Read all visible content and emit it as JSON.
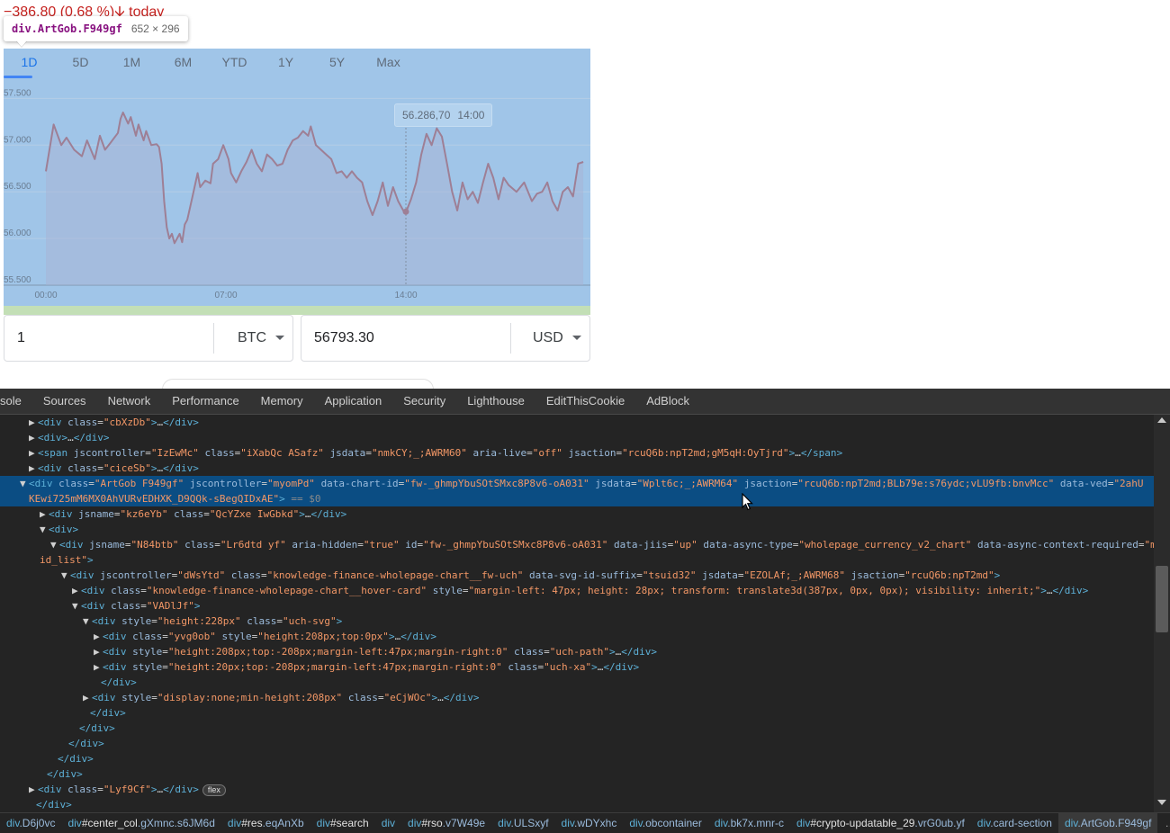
{
  "web": {
    "price_change": "−386.80 (0.68 %)🡫 today",
    "inspector_tooltip": {
      "tag": "div.ArtGob.F949gf",
      "size": "652 × 296"
    },
    "chart": {
      "tabs": [
        "1D",
        "5D",
        "1M",
        "6M",
        "YTD",
        "1Y",
        "5Y",
        "Max"
      ],
      "active_tab": "1D",
      "hover_price": "56.286,70",
      "hover_time": "14:00"
    },
    "converter": {
      "amount_from": "1",
      "unit_from": "BTC",
      "amount_to": "56793.30",
      "unit_to": "USD"
    }
  },
  "chart_data": {
    "type": "line",
    "x_ticks": [
      "00:00",
      "07:00",
      "14:00"
    ],
    "y_ticks": [
      "57.500",
      "57.000",
      "56.500",
      "56.000",
      "55.500"
    ],
    "ylim": [
      55500,
      57600
    ],
    "x_range": [
      0,
      21
    ],
    "grid": true,
    "line_color": "#9e7f95",
    "hover": {
      "x": 14,
      "y": 56286.7
    },
    "series": [
      {
        "values": [
          [
            0.0,
            56720
          ],
          [
            0.3,
            57220
          ],
          [
            0.6,
            57000
          ],
          [
            0.8,
            57080
          ],
          [
            1.1,
            56950
          ],
          [
            1.4,
            56880
          ],
          [
            1.6,
            57050
          ],
          [
            1.9,
            56850
          ],
          [
            2.1,
            57100
          ],
          [
            2.3,
            56950
          ],
          [
            2.5,
            57020
          ],
          [
            2.8,
            57130
          ],
          [
            2.9,
            57280
          ],
          [
            3.0,
            57350
          ],
          [
            3.2,
            57230
          ],
          [
            3.3,
            57300
          ],
          [
            3.5,
            57100
          ],
          [
            3.6,
            57220
          ],
          [
            3.8,
            57050
          ],
          [
            3.9,
            57150
          ],
          [
            4.1,
            57000
          ],
          [
            4.3,
            57010
          ],
          [
            4.4,
            56980
          ],
          [
            4.5,
            56800
          ],
          [
            4.6,
            56400
          ],
          [
            4.7,
            56120
          ],
          [
            4.8,
            56000
          ],
          [
            4.9,
            56050
          ],
          [
            5.0,
            55950
          ],
          [
            5.2,
            56050
          ],
          [
            5.3,
            55960
          ],
          [
            5.4,
            56150
          ],
          [
            5.5,
            56200
          ],
          [
            5.7,
            56450
          ],
          [
            5.9,
            56700
          ],
          [
            6.0,
            56550
          ],
          [
            6.2,
            56620
          ],
          [
            6.4,
            56590
          ],
          [
            6.5,
            56800
          ],
          [
            6.7,
            56850
          ],
          [
            6.9,
            57000
          ],
          [
            7.1,
            56850
          ],
          [
            7.2,
            56700
          ],
          [
            7.4,
            56600
          ],
          [
            7.6,
            56720
          ],
          [
            7.8,
            56820
          ],
          [
            8.0,
            56950
          ],
          [
            8.2,
            56800
          ],
          [
            8.4,
            56720
          ],
          [
            8.6,
            56900
          ],
          [
            8.8,
            56850
          ],
          [
            9.0,
            56780
          ],
          [
            9.2,
            56800
          ],
          [
            9.4,
            56950
          ],
          [
            9.6,
            57050
          ],
          [
            9.8,
            57080
          ],
          [
            10.0,
            57150
          ],
          [
            10.2,
            57100
          ],
          [
            10.3,
            57200
          ],
          [
            10.5,
            57000
          ],
          [
            10.7,
            56950
          ],
          [
            10.9,
            56900
          ],
          [
            11.1,
            56850
          ],
          [
            11.3,
            56700
          ],
          [
            11.5,
            56720
          ],
          [
            11.7,
            56650
          ],
          [
            11.9,
            56720
          ],
          [
            12.1,
            56650
          ],
          [
            12.3,
            56600
          ],
          [
            12.5,
            56400
          ],
          [
            12.7,
            56250
          ],
          [
            12.9,
            56400
          ],
          [
            13.1,
            56600
          ],
          [
            13.3,
            56350
          ],
          [
            13.5,
            56550
          ],
          [
            13.7,
            56400
          ],
          [
            13.9,
            56300
          ],
          [
            14.0,
            56280
          ],
          [
            14.2,
            56420
          ],
          [
            14.4,
            56600
          ],
          [
            14.6,
            56900
          ],
          [
            14.8,
            57120
          ],
          [
            15.0,
            57000
          ],
          [
            15.2,
            57180
          ],
          [
            15.4,
            57090
          ],
          [
            15.6,
            56800
          ],
          [
            15.8,
            56500
          ],
          [
            16.0,
            56300
          ],
          [
            16.2,
            56600
          ],
          [
            16.4,
            56420
          ],
          [
            16.6,
            56500
          ],
          [
            16.8,
            56380
          ],
          [
            17.0,
            56600
          ],
          [
            17.2,
            56800
          ],
          [
            17.4,
            56650
          ],
          [
            17.6,
            56420
          ],
          [
            17.8,
            56650
          ],
          [
            18.0,
            56570
          ],
          [
            18.3,
            56500
          ],
          [
            18.6,
            56600
          ],
          [
            18.9,
            56400
          ],
          [
            19.1,
            56480
          ],
          [
            19.3,
            56500
          ],
          [
            19.5,
            56600
          ],
          [
            19.7,
            56400
          ],
          [
            19.9,
            56300
          ],
          [
            20.1,
            56500
          ],
          [
            20.3,
            56550
          ],
          [
            20.5,
            56450
          ],
          [
            20.7,
            56800
          ],
          [
            20.9,
            56820
          ]
        ]
      }
    ]
  },
  "devtools": {
    "tabs": [
      "sole",
      "Sources",
      "Network",
      "Performance",
      "Memory",
      "Application",
      "Security",
      "Lighthouse",
      "EditThisCookie",
      "AdBlock"
    ],
    "lines": [
      "▶<div class=\"cbXzDb\">…</div>",
      "▶<div>…</div>",
      "▶<span jscontroller=\"IzEwMc\" class=\"iXabQc ASafz\" jsdata=\"nmkCY;_;AWRM60\" aria-live=\"off\" jsaction=\"rcuQ6b:npT2md;gM5qH:OyTjrd\">…</span>",
      "▶<div class=\"ciceSb\">…</div>",
      "▼<div class=\"ArtGob F949gf\" jscontroller=\"myomPd\" data-chart-id=\"fw-_ghmpYbuSOtSMxc8P8v6-oA031\" jsdata=\"Wplt6c;_;AWRM64\" jsaction=\"rcuQ6b:npT2md;BLb79e:s76ydc;vLU9fb:bnvMcc\" data-ved=\"2ahU",
      "KEwi725mM6MX0AhVURvEDHXK_D9QQk-sBegQIDxAE\"> == $0",
      "▶<div jsname=\"kz6eYb\" class=\"QcYZxe IwGbkd\">…</div>",
      "▼<div>",
      "▼<div jsname=\"N84btb\" class=\"Lr6dtd yf\" aria-hidden=\"true\" id=\"fw-_ghmpYbuSOtSMxc8P8v6-oA031\" data-jiis=\"up\" data-async-type=\"wholepage_currency_v2_chart\" data-async-context-required=\"m",
      "id_list\">",
      "▼<div jscontroller=\"dWsYtd\" class=\"knowledge-finance-wholepage-chart__fw-uch\" data-svg-id-suffix=\"tsuid32\" jsdata=\"EZOLAf;_;AWRM68\" jsaction=\"rcuQ6b:npT2md\">",
      "▶<div class=\"knowledge-finance-wholepage-chart__hover-card\" style=\"margin-left: 47px; height: 28px; transform: translate3d(387px, 0px, 0px); visibility: inherit;\">…</div>",
      "▼<div class=\"VADlJf\">",
      "▼<div style=\"height:228px\" class=\"uch-svg\">",
      "▶<div class=\"yvg0ob\" style=\"height:208px;top:0px\">…</div>",
      "▶<div style=\"height:208px;top:-208px;margin-left:47px;margin-right:0\" class=\"uch-path\">…</div>",
      "▶<div style=\"height:20px;top:-208px;margin-left:47px;margin-right:0\" class=\"uch-xa\">…</div>",
      "</div>",
      "▶<div style=\"display:none;min-height:208px\" class=\"eCjWOc\">…</div>",
      "</div>",
      "</div>",
      "</div>",
      "</div>",
      "</div>",
      "▶<div class=\"Lyf9Cf\">…</div>",
      "</div>"
    ],
    "flex_badge": "flex",
    "breadcrumbs": [
      "div.D6j0vc",
      "div#center_col.gXmnc.s6JM6d",
      "div#res.eqAnXb",
      "div#search",
      "div",
      "div#rso.v7W49e",
      "div.ULSxyf",
      "div.wDYxhc",
      "div.obcontainer",
      "div.bk7x.mnr-c",
      "div#crypto-updatable_29.vrG0ub.yf",
      "div.card-section",
      "div.ArtGob.F949gf"
    ],
    "breadcrumb_more": "…"
  }
}
